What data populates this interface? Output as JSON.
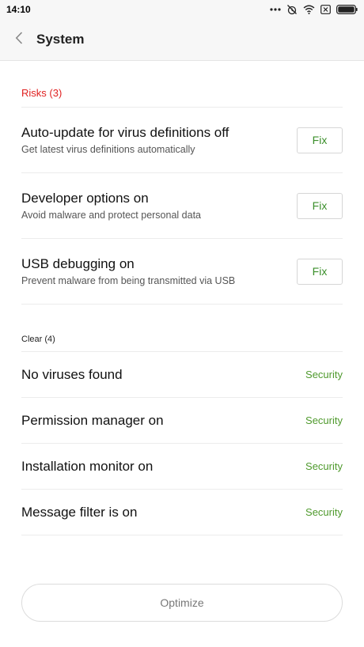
{
  "status_bar": {
    "time": "14:10",
    "icons": [
      "more-dots-icon",
      "alarm-off-icon",
      "wifi-icon",
      "sim-card-icon",
      "battery-icon"
    ]
  },
  "header": {
    "back_icon": "chevron-left-icon",
    "title": "System"
  },
  "risks": {
    "heading": "Risks (3)",
    "heading_color": "#e02020",
    "items": [
      {
        "title": "Auto-update for virus definitions off",
        "subtitle": "Get latest virus definitions automatically",
        "action": "Fix"
      },
      {
        "title": "Developer options on",
        "subtitle": "Avoid malware and protect personal data",
        "action": "Fix"
      },
      {
        "title": "USB debugging on",
        "subtitle": "Prevent malware from being transmitted via USB",
        "action": "Fix"
      }
    ]
  },
  "clear": {
    "heading": "Clear (4)",
    "tag_color": "#4f9a2d",
    "items": [
      {
        "title": "No viruses found",
        "tag": "Security"
      },
      {
        "title": "Permission manager on",
        "tag": "Security"
      },
      {
        "title": "Installation monitor on",
        "tag": "Security"
      },
      {
        "title": "Message filter is on",
        "tag": "Security"
      }
    ]
  },
  "footer": {
    "optimize_label": "Optimize"
  }
}
